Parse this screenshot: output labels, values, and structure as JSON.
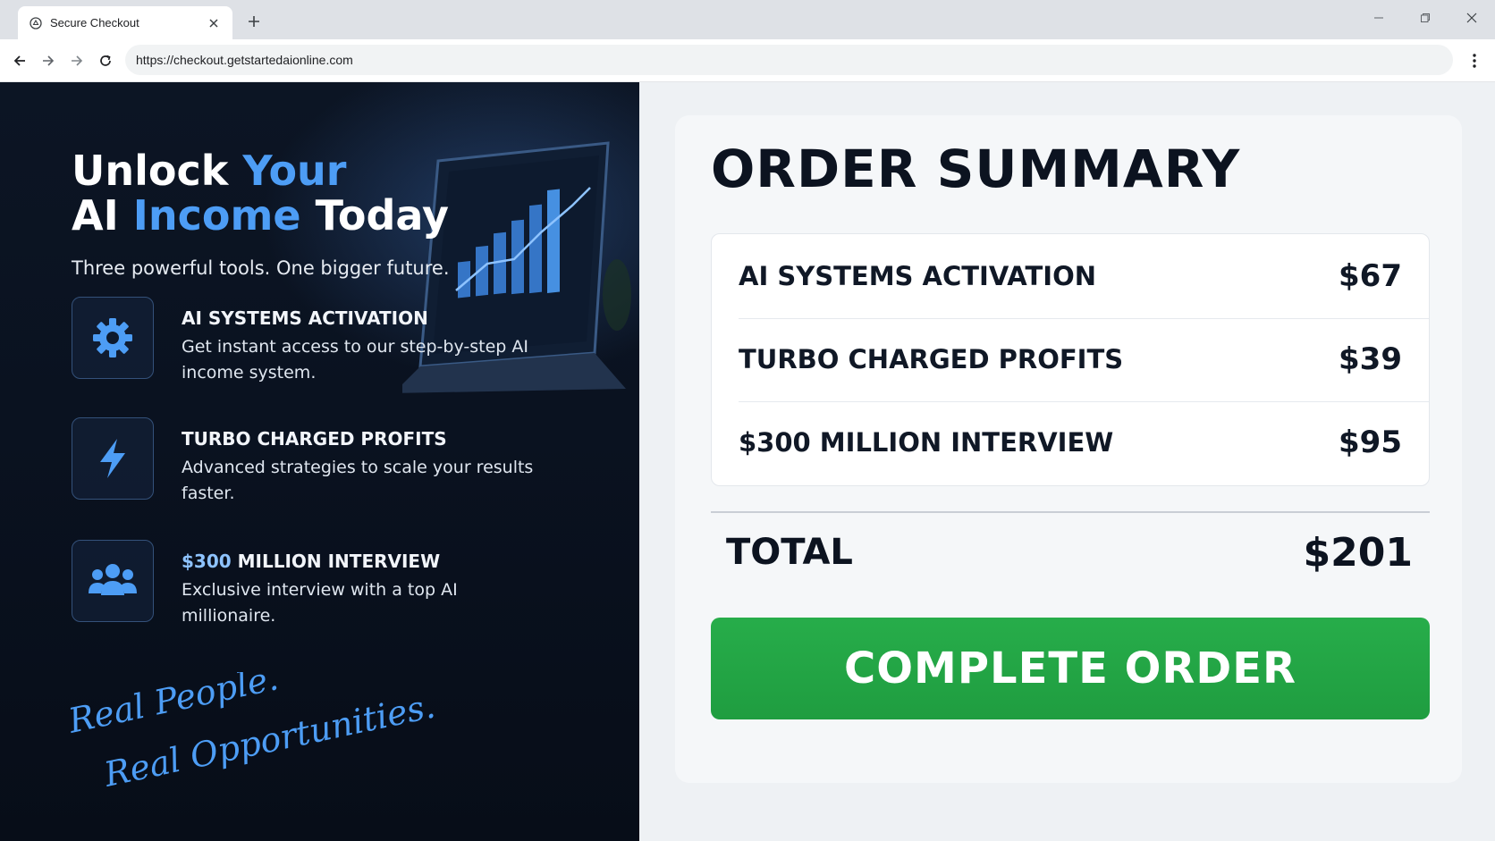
{
  "browser": {
    "tab_title": "Secure Checkout",
    "url": "https://checkout.getstartedaionline.com"
  },
  "hero": {
    "headline_line1_a": "Unlock",
    "headline_line1_b": "Your",
    "headline_line2_a": "AI",
    "headline_line2_b": "Income",
    "headline_line2_c": "Today",
    "tagline": "Three powerful tools. One bigger future.",
    "features": [
      {
        "icon": "gear-icon",
        "title": "AI SYSTEMS ACTIVATION",
        "description": "Get instant access to our step-by-step AI income system."
      },
      {
        "icon": "lightning-icon",
        "title": "TURBO CHARGED PROFITS",
        "description": "Advanced strategies to scale your results faster."
      },
      {
        "icon": "people-icon",
        "title_accent": "$300",
        "title": "MILLION INTERVIEW",
        "description": "Exclusive interview with a top AI millionaire."
      }
    ],
    "script_line1": "Real People.",
    "script_line2": "Real Opportunities."
  },
  "order": {
    "heading": "ORDER SUMMARY",
    "items": [
      {
        "name": "AI SYSTEMS ACTIVATION",
        "price": "$67"
      },
      {
        "name": "TURBO CHARGED PROFITS",
        "price": "$39"
      },
      {
        "name": "$300 MILLION INTERVIEW",
        "price": "$95"
      }
    ],
    "total_label": "TOTAL",
    "total_value": "$201",
    "cta_label": "COMPLETE ORDER"
  },
  "colors": {
    "accent_blue": "#4d9df5",
    "cta_green": "#27ad4a",
    "hero_bg": "#0a1220"
  }
}
